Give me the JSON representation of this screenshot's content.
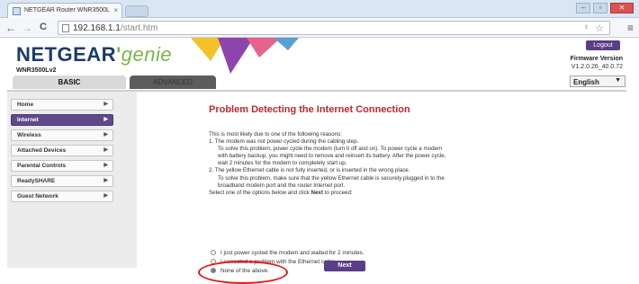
{
  "browser": {
    "tab_title": "NETGEAR Router WNR3500L",
    "tab_close": "×",
    "url_host": "192.168.1.1",
    "url_path": "/start.htm",
    "back": "←",
    "forward": "→",
    "reload": "C"
  },
  "header": {
    "logo_brand": "NETGEAR",
    "logo_genie": "genie",
    "model": "WNR3500Lv2",
    "logout_label": "Logout",
    "firmware_label": "Firmware Version",
    "firmware_value": "V1.2.0.26_40.0.72",
    "language": "English"
  },
  "tabs": {
    "basic": "BASIC",
    "advanced": "ADVANCED"
  },
  "sidebar": {
    "items": [
      {
        "label": "Home"
      },
      {
        "label": "Internet"
      },
      {
        "label": "Wireless"
      },
      {
        "label": "Attached Devices"
      },
      {
        "label": "Parental Controls"
      },
      {
        "label": "ReadySHARE"
      },
      {
        "label": "Guest Network"
      }
    ],
    "active_index": 1
  },
  "main": {
    "title": "Problem Detecting the Internet Connection",
    "intro": "This is most likely due to one of the following reasons:",
    "reason1": "1.  The modem was not power cycled during the cabling step.",
    "reason1_a": "To solve this problem, power cycle the modem (turn it off and on). To power cycle a modem",
    "reason1_b": "with battery backup, you might need to remove and reinsert its battery. After the power cycle,",
    "reason1_c": "wait 2 minutes for the modem to completely start up.",
    "reason2": "2.  The yellow Ethernet cable is not fully inserted, or is inserted in the wrong place.",
    "reason2_a": "To solve this problem, make sure that the yellow Ethernet cable is securely plugged in to the",
    "reason2_b": "broadband modem port and the router Internet port.",
    "select_prefix": "Select one of the options below and click ",
    "select_next": "Next",
    "select_suffix": " to proceed:",
    "option1": "I just power cycled the modem and waited for 2 minutes.",
    "option2": "I corrected a problem with the Ethernet cable.",
    "option3": "None of the above.",
    "selected_option": 3,
    "next_button": "Next"
  }
}
